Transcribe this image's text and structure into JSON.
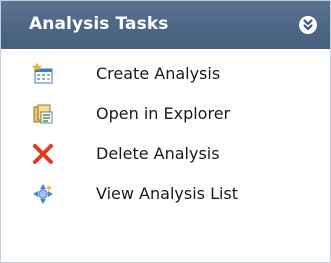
{
  "panel": {
    "title": "Analysis Tasks",
    "collapse_icon": "double-chevron-down-icon"
  },
  "tasks": [
    {
      "label": "Create Analysis",
      "icon": "create-analysis-icon"
    },
    {
      "label": "Open in Explorer",
      "icon": "open-in-explorer-icon"
    },
    {
      "label": "Delete Analysis",
      "icon": "delete-x-icon"
    },
    {
      "label": "View Analysis List",
      "icon": "view-list-icon"
    }
  ],
  "colors": {
    "header_bg": "#4e6685",
    "header_text": "#ffffff",
    "delete_red": "#e03a1e",
    "border": "#c7ccd4"
  }
}
